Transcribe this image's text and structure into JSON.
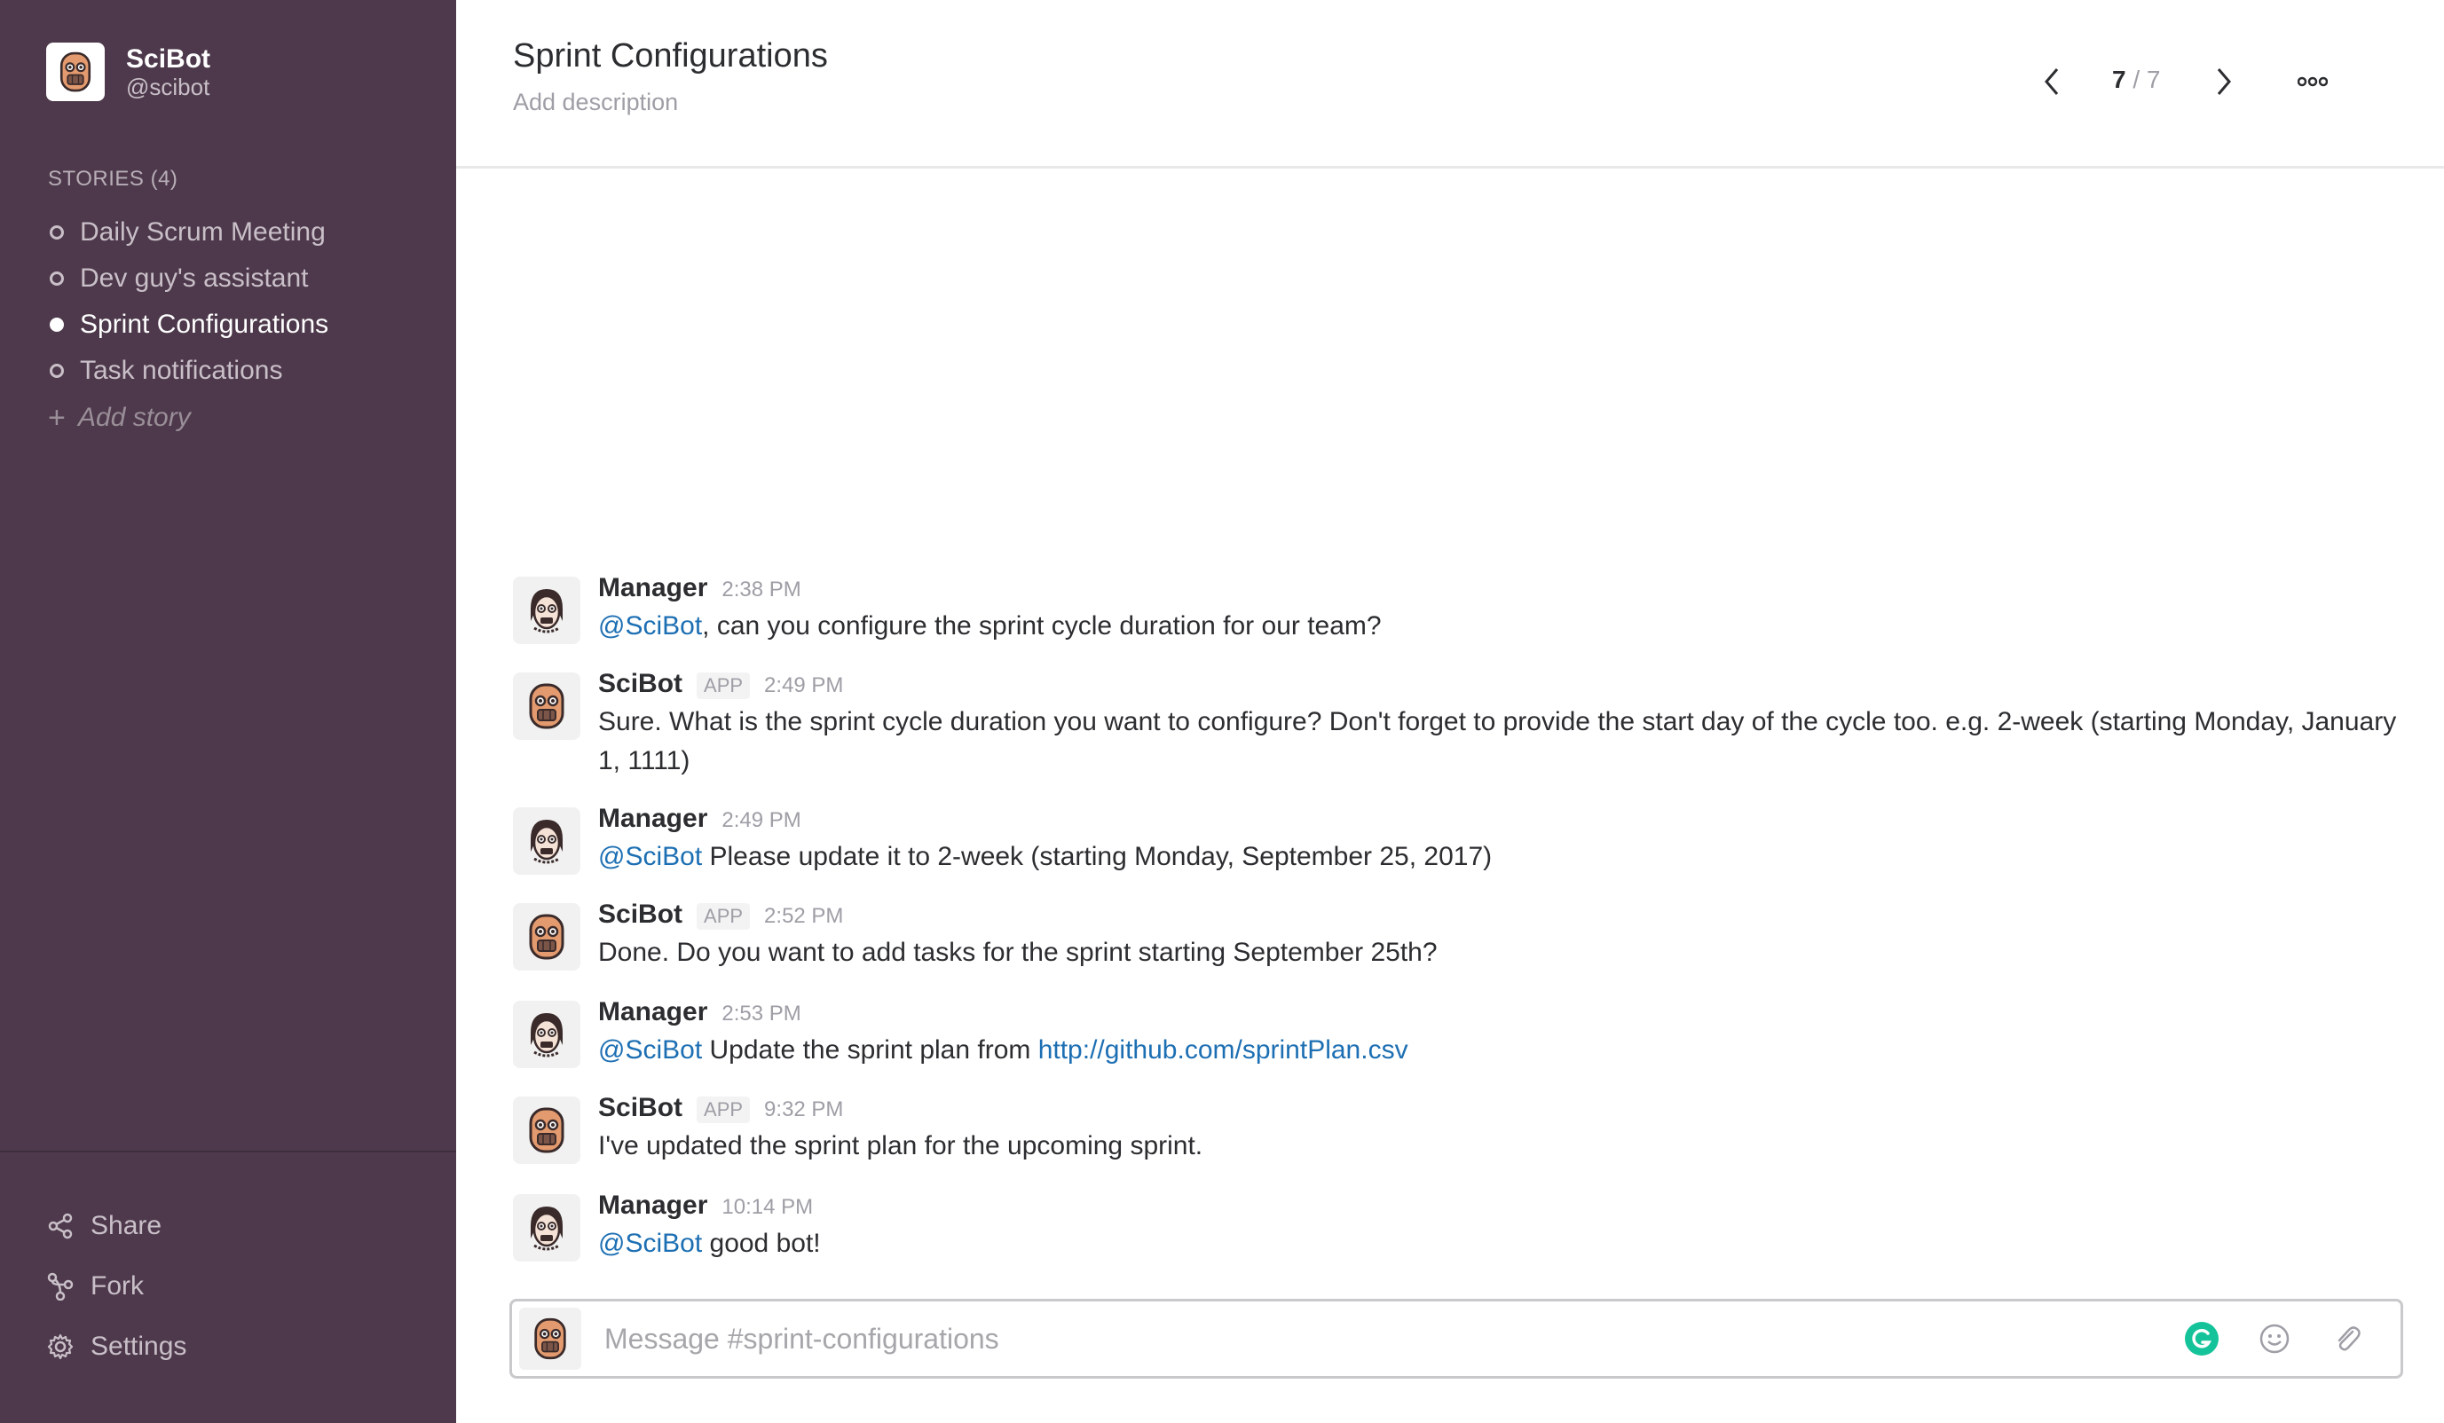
{
  "workspace": {
    "name": "SciBot",
    "handle": "@scibot"
  },
  "sidebar": {
    "section_label": "STORIES (4)",
    "stories": [
      {
        "label": "Daily Scrum Meeting",
        "active": false
      },
      {
        "label": "Dev guy's assistant",
        "active": false
      },
      {
        "label": "Sprint Configurations",
        "active": true
      },
      {
        "label": "Task notifications",
        "active": false
      }
    ],
    "add_story_label": "Add story",
    "actions": {
      "share": "Share",
      "fork": "Fork",
      "settings": "Settings"
    }
  },
  "header": {
    "title": "Sprint Configurations",
    "description_placeholder": "Add description",
    "page_current": "7",
    "page_separator": "/ 7"
  },
  "messages": [
    {
      "author": "Manager",
      "time": "2:38 PM",
      "mention": "@SciBot",
      "text": ", can you configure the sprint cycle duration for our team?"
    },
    {
      "author": "SciBot",
      "app_badge": "APP",
      "time": "2:49 PM",
      "text": "Sure. What is the sprint cycle duration you want to configure? Don't forget to provide the start day of the cycle too. e.g. 2-week (starting Monday, January 1, 1111)"
    },
    {
      "author": "Manager",
      "time": "2:49 PM",
      "mention": "@SciBot",
      "text": " Please update it to 2-week (starting Monday, September 25, 2017)"
    },
    {
      "author": "SciBot",
      "app_badge": "APP",
      "time": "2:52 PM",
      "text": "Done. Do you want to add tasks for the sprint starting September 25th?"
    },
    {
      "author": "Manager",
      "time": "2:53 PM",
      "mention": "@SciBot",
      "text": " Update the sprint plan from ",
      "link": "http://github.com/sprintPlan.csv"
    },
    {
      "author": "SciBot",
      "app_badge": "APP",
      "time": "9:32 PM",
      "text": "I've updated the sprint plan for the upcoming sprint."
    },
    {
      "author": "Manager",
      "time": "10:14 PM",
      "mention": "@SciBot",
      "text": " good bot!"
    }
  ],
  "composer": {
    "placeholder": "Message #sprint-configurations"
  },
  "colors": {
    "sidebar_bg": "#4d394b",
    "mention": "#1d6fb3",
    "grammarly": "#15c39a"
  },
  "icons": {
    "prev": "chevron-left-icon",
    "next": "chevron-right-icon",
    "more": "more-icon",
    "share": "share-icon",
    "fork": "fork-icon",
    "settings": "gear-icon",
    "emoji": "emoji-icon",
    "attach": "paperclip-icon",
    "grammarly": "grammarly-icon"
  }
}
